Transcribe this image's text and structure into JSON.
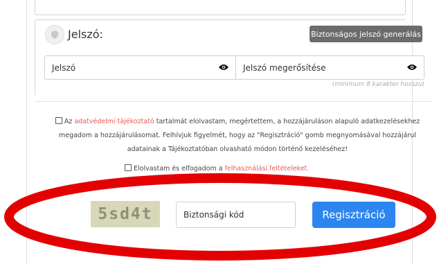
{
  "password_section": {
    "title": "Jelszó",
    "generate_button": "Biztonságos jelszó generálás",
    "password_placeholder": "Jelszó",
    "confirm_placeholder": "Jelszó megerősítése",
    "hint": "(minimum 8 karakter hosszú)",
    "icons": {
      "section": "shield-icon",
      "toggle": "eye-icon"
    }
  },
  "consent": {
    "privacy_prefix": "Az ",
    "privacy_link": "adatvédelmi tájékoztató",
    "privacy_text": " tartalmát elolvastam, megértettem, a hozzájáruláson alapuló adatkezelésekhez megadom a hozzájárulásomat. Felhívjuk figyelmét, hogy az \"Regisztráció\" gomb megnyomásával hozzájárul adatainak a Tájékoztatóban olvasható módon történő kezeléséhez!",
    "terms_prefix": "Elolvastam és elfogadom a ",
    "terms_link": "felhasználási feltételeket."
  },
  "captcha": {
    "code": "5sd4t",
    "input_placeholder": "Biztonsági kód"
  },
  "register_button": "Regisztráció",
  "colors": {
    "accent": "#2d86f0",
    "link": "#e45a5a",
    "annotation": "#e30000"
  }
}
